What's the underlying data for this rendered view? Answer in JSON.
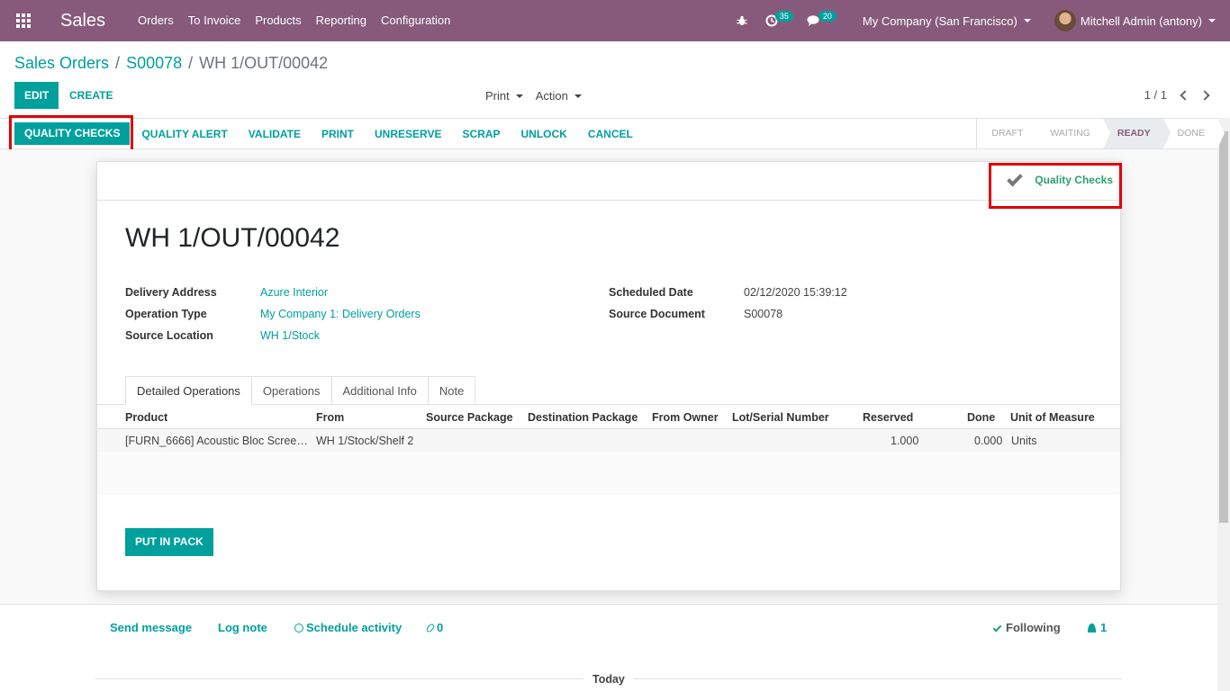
{
  "navbar": {
    "app_name": "Sales",
    "menu": [
      "Orders",
      "To Invoice",
      "Products",
      "Reporting",
      "Configuration"
    ],
    "activity_count": "35",
    "message_count": "20",
    "company": "My Company (San Francisco)",
    "user": "Mitchell Admin (antony)"
  },
  "breadcrumb": {
    "level1": "Sales Orders",
    "level2": "S00078",
    "current": "WH 1/OUT/00042",
    "separator": "/"
  },
  "control": {
    "edit_label": "EDIT",
    "create_label": "CREATE",
    "print_label": "Print",
    "action_label": "Action",
    "pager": "1 / 1"
  },
  "statusbar": {
    "buttons": [
      "QUALITY CHECKS",
      "QUALITY ALERT",
      "VALIDATE",
      "PRINT",
      "UNRESERVE",
      "SCRAP",
      "UNLOCK",
      "CANCEL"
    ],
    "stages": [
      "DRAFT",
      "WAITING",
      "READY",
      "DONE"
    ],
    "current_stage": "READY"
  },
  "smart_button": {
    "label": "Quality Checks"
  },
  "record": {
    "title": "WH 1/OUT/00042",
    "fields": {
      "delivery_address": {
        "label": "Delivery Address",
        "value": "Azure Interior"
      },
      "operation_type": {
        "label": "Operation Type",
        "value": "My Company 1: Delivery Orders"
      },
      "source_location": {
        "label": "Source Location",
        "value": "WH 1/Stock"
      },
      "scheduled_date": {
        "label": "Scheduled Date",
        "value": "02/12/2020 15:39:12"
      },
      "source_document": {
        "label": "Source Document",
        "value": "S00078"
      }
    }
  },
  "tabs": [
    "Detailed Operations",
    "Operations",
    "Additional Info",
    "Note"
  ],
  "table": {
    "columns": [
      "Product",
      "From",
      "Source Package",
      "Destination Package",
      "From Owner",
      "Lot/Serial Number",
      "Reserved",
      "Done",
      "Unit of Measure"
    ],
    "rows": [
      {
        "product": "[FURN_6666] Acoustic Bloc Scree…",
        "from": "WH 1/Stock/Shelf 2",
        "reserved": "1.000",
        "done": "0.000",
        "uom": "Units"
      }
    ]
  },
  "put_in_pack_label": "PUT IN PACK",
  "chatter": {
    "send_message": "Send message",
    "log_note": "Log note",
    "schedule_activity": "Schedule activity",
    "attachments": "0",
    "following": "Following",
    "followers": "1",
    "today": "Today"
  }
}
